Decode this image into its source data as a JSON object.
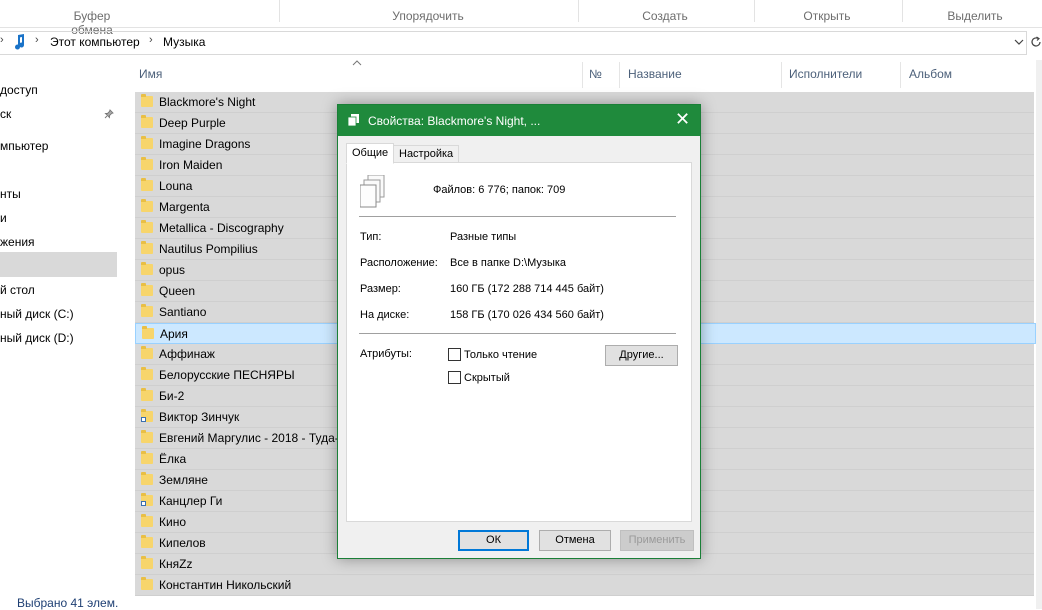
{
  "ribbon": {
    "groups": [
      "Буфер обмена",
      "Упорядочить",
      "Создать",
      "Открыть",
      "Выделить"
    ]
  },
  "address": {
    "crumbs": [
      "Этот компьютер",
      "Музыка"
    ],
    "refresh_icon": "refresh-icon",
    "dropdown_icon": "chevron-down-icon"
  },
  "sidebar": {
    "items": [
      "доступ",
      "ск",
      "мпьютер",
      "нты",
      "и",
      "жения",
      "й стол",
      "ный диск (C:)",
      "ный диск (D:)"
    ]
  },
  "status": {
    "text": "Выбрано 41 элем."
  },
  "columns": {
    "name": "Имя",
    "number": "№",
    "title": "Название",
    "artists": "Исполнители",
    "album": "Альбом"
  },
  "files": [
    {
      "name": "Blackmore's Night",
      "shortcut": false
    },
    {
      "name": "Deep Purple",
      "shortcut": false
    },
    {
      "name": "Imagine Dragons",
      "shortcut": false
    },
    {
      "name": "Iron Maiden",
      "shortcut": false
    },
    {
      "name": "Louna",
      "shortcut": false
    },
    {
      "name": "Margenta",
      "shortcut": false
    },
    {
      "name": "Metallica - Discography",
      "shortcut": false
    },
    {
      "name": "Nautilus Pompilius",
      "shortcut": false
    },
    {
      "name": "opus",
      "shortcut": false
    },
    {
      "name": "Queen",
      "shortcut": false
    },
    {
      "name": "Santiano",
      "shortcut": false
    },
    {
      "name": "Ария",
      "shortcut": false
    },
    {
      "name": "Аффинаж",
      "shortcut": false
    },
    {
      "name": "Белорусские ПЕСНЯРЫ",
      "shortcut": false
    },
    {
      "name": "Би-2",
      "shortcut": false
    },
    {
      "name": "Виктор Зинчук",
      "shortcut": true
    },
    {
      "name": "Евгений Маргулис - 2018 - Туда-",
      "shortcut": false
    },
    {
      "name": "Ёлка",
      "shortcut": false
    },
    {
      "name": "Земляне",
      "shortcut": false
    },
    {
      "name": "Канцлер Ги",
      "shortcut": true
    },
    {
      "name": "Кино",
      "shortcut": false
    },
    {
      "name": "Кипелов",
      "shortcut": false
    },
    {
      "name": "КняZz",
      "shortcut": false
    },
    {
      "name": "Константин Никольский",
      "shortcut": false
    }
  ],
  "selected_file": "Ария",
  "dialog": {
    "title": "Свойства: Blackmore's Night, ...",
    "tabs": [
      "Общие",
      "Настройка"
    ],
    "summary": "Файлов: 6 776; папок: 709",
    "type_label": "Тип:",
    "type_value": "Разные типы",
    "location_label": "Расположение:",
    "location_value": "Все в папке D:\\Музыка",
    "size_label": "Размер:",
    "size_value": "160 ГБ (172 288 714 445 байт)",
    "disk_label": "На диске:",
    "disk_value": "158 ГБ (170 026 434 560 байт)",
    "attributes_label": "Атрибуты:",
    "readonly_label": "Только чтение",
    "hidden_label": "Скрытый",
    "other_button": "Другие...",
    "ok_button": "ОК",
    "cancel_button": "Отмена",
    "apply_button": "Применить"
  },
  "colors": {
    "dialog_title": "#1f8a3c",
    "selection": "#cce8ff",
    "folder": "#f7d56c"
  }
}
